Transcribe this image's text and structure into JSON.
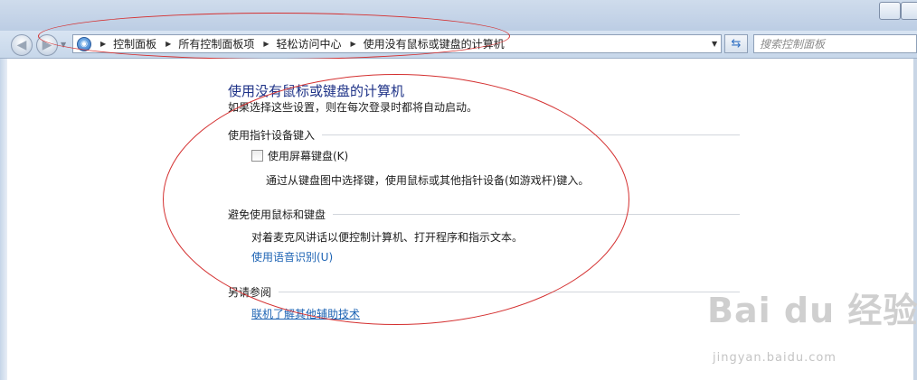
{
  "addressbar": {
    "crumbs": [
      "控制面板",
      "所有控制面板项",
      "轻松访问中心",
      "使用没有鼠标或键盘的计算机"
    ]
  },
  "search": {
    "placeholder": "搜索控制面板"
  },
  "main": {
    "title": "使用没有鼠标或键盘的计算机",
    "subtitle": "如果选择这些设置，则在每次登录时都将自动启动。",
    "sections": [
      {
        "heading": "使用指针设备键入",
        "checkbox_label": "使用屏幕键盘(K)",
        "checkbox_checked": false,
        "description": "通过从键盘图中选择键，使用鼠标或其他指针设备(如游戏杆)键入。"
      },
      {
        "heading": "避免使用鼠标和键盘",
        "description": "对着麦克风讲话以便控制计算机、打开程序和指示文本。",
        "link": "使用语音识别(U)"
      },
      {
        "heading": "另请参阅",
        "link": "联机了解其他辅助技术"
      }
    ]
  },
  "icons": {
    "back": "back-arrow-icon",
    "forward": "forward-arrow-icon",
    "control_panel": "control-panel-icon",
    "refresh": "refresh-icon"
  },
  "colors": {
    "title": "#1e3287",
    "link": "#1e64b4",
    "annotation": "#d43030"
  },
  "watermark": {
    "logo": "Bai du 经验",
    "url": "jingyan.baidu.com"
  }
}
